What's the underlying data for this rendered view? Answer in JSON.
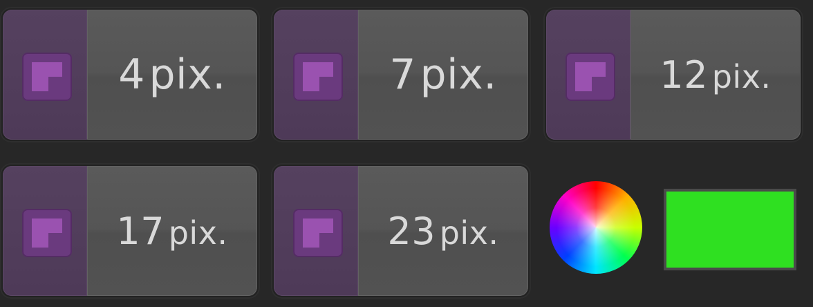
{
  "brush_sizes": [
    {
      "number": "4",
      "unit": "pix."
    },
    {
      "number": "7",
      "unit": "pix."
    },
    {
      "number": "12",
      "unit": "pix."
    },
    {
      "number": "17",
      "unit": "pix."
    },
    {
      "number": "23",
      "unit": "pix."
    }
  ],
  "colors": {
    "brush_swatch": "#6a3a7e",
    "current_color": "#2fe021"
  },
  "icons": {
    "color_picker": "color-wheel-icon"
  }
}
